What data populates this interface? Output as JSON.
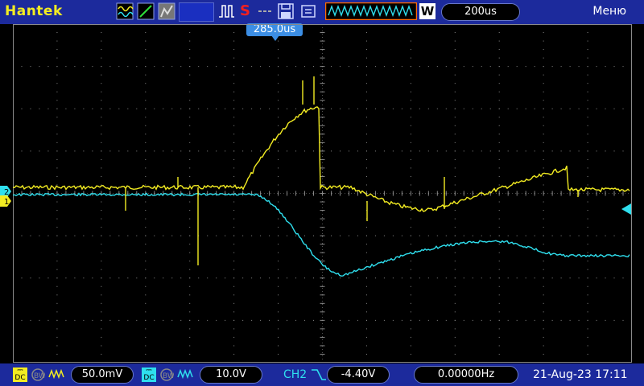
{
  "header": {
    "brand": "Hantek",
    "run_state": "S",
    "timebase": "200us",
    "menu_label": "Меню",
    "trigger_position": "285.0us",
    "icons": [
      "waveform-mode-icon",
      "cursor-icon",
      "persistence-icon",
      "math-icon",
      "trigger-edge-icon",
      "save-icon",
      "measure-icon",
      "waveform-window-icon",
      "w-icon"
    ]
  },
  "channels": {
    "ch1": {
      "coupling": "DC",
      "volts_div": "50.0mV",
      "color": "#f3ec22",
      "marker": "1"
    },
    "ch2": {
      "coupling": "DC",
      "volts_div": "10.0V",
      "color": "#2fdfee",
      "marker": "2"
    }
  },
  "trigger": {
    "source": "CH2",
    "slope": "falling",
    "level": "-4.40V",
    "frequency": "0.00000Hz"
  },
  "datetime": "21-Aug-23 17:11",
  "colors": {
    "bar": "#1c2a9c",
    "grid": "#8a8a8a",
    "ch1": "#f3ec22",
    "ch2": "#2fdfee",
    "trigger_marker": "#3c8ee4"
  }
}
